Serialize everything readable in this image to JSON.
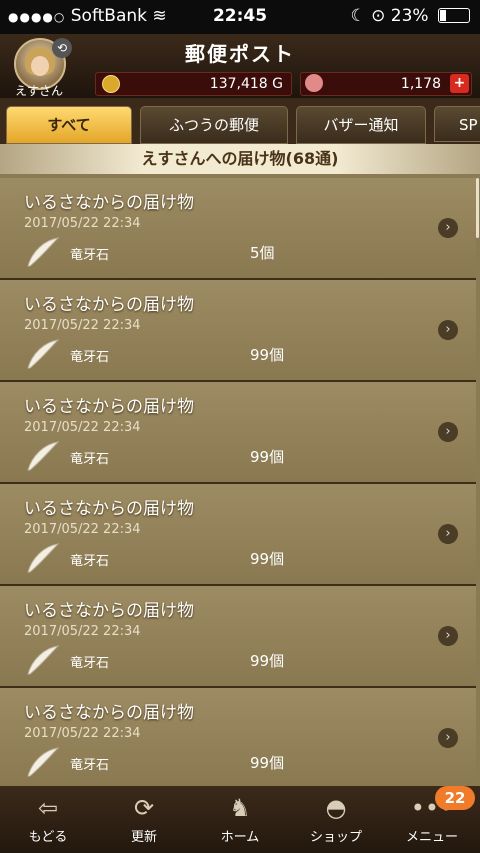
{
  "status_bar": {
    "signal": "●●●●○",
    "carrier": "SoftBank",
    "time": "22:45",
    "battery": "23%"
  },
  "header": {
    "title": "郵便ポスト",
    "username": "えすさん",
    "gold": "137,418 G",
    "gems": "1,178",
    "plus_label": "+"
  },
  "tabs": [
    {
      "label": "すべて",
      "active": true
    },
    {
      "label": "ふつうの郵便"
    },
    {
      "label": "バザー通知"
    },
    {
      "label": "SP"
    }
  ],
  "section_title": "えすさんへの届け物(68通)",
  "mail": [
    {
      "sender": "いるさなからの届け物",
      "date": "2017/05/22 22:34",
      "item": "竜牙石",
      "qty": "5個"
    },
    {
      "sender": "いるさなからの届け物",
      "date": "2017/05/22 22:34",
      "item": "竜牙石",
      "qty": "99個"
    },
    {
      "sender": "いるさなからの届け物",
      "date": "2017/05/22 22:34",
      "item": "竜牙石",
      "qty": "99個"
    },
    {
      "sender": "いるさなからの届け物",
      "date": "2017/05/22 22:34",
      "item": "竜牙石",
      "qty": "99個"
    },
    {
      "sender": "いるさなからの届け物",
      "date": "2017/05/22 22:34",
      "item": "竜牙石",
      "qty": "99個"
    },
    {
      "sender": "いるさなからの届け物",
      "date": "2017/05/22 22:34",
      "item": "竜牙石",
      "qty": "99個"
    }
  ],
  "nav": [
    {
      "label": "もどる",
      "icon": "back-arrow-icon",
      "glyph": "⇦"
    },
    {
      "label": "更新",
      "icon": "refresh-icon",
      "glyph": "⟳"
    },
    {
      "label": "ホーム",
      "icon": "home-monster-icon",
      "glyph": "♞"
    },
    {
      "label": "ショップ",
      "icon": "slime-shop-icon",
      "glyph": "◓"
    },
    {
      "label": "メニュー",
      "icon": "menu-dots-icon",
      "glyph": "•••"
    }
  ],
  "menu_badge": "22",
  "colors": {
    "active_tab": "#ffd972",
    "badge": "#f07b2a",
    "plus": "#d62b1e"
  }
}
